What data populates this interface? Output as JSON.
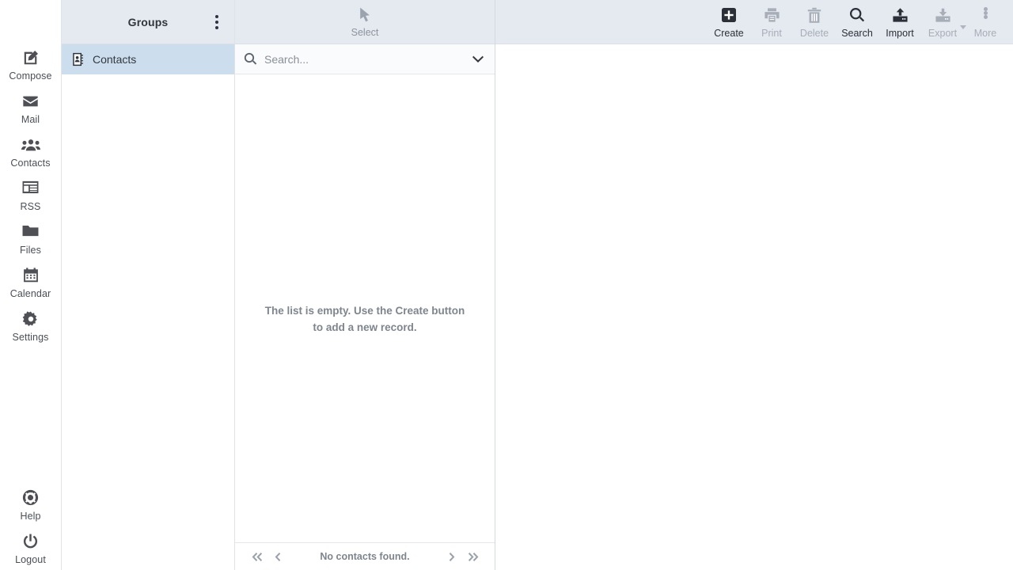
{
  "taskbar": {
    "items": [
      {
        "label": "Compose",
        "icon": "compose-icon"
      },
      {
        "label": "Mail",
        "icon": "envelope-icon"
      },
      {
        "label": "Contacts",
        "icon": "people-icon"
      },
      {
        "label": "RSS",
        "icon": "rss-list-icon"
      },
      {
        "label": "Files",
        "icon": "folder-icon"
      },
      {
        "label": "Calendar",
        "icon": "calendar-icon"
      },
      {
        "label": "Settings",
        "icon": "gear-icon"
      }
    ],
    "bottom_items": [
      {
        "label": "Help",
        "icon": "lifebuoy-icon"
      },
      {
        "label": "Logout",
        "icon": "power-icon"
      }
    ]
  },
  "groups": {
    "title": "Groups",
    "options_icon": "kebab-menu-icon",
    "items": [
      {
        "label": "Contacts",
        "icon": "addressbook-icon",
        "selected": true
      }
    ]
  },
  "list": {
    "select_button": {
      "label": "Select",
      "icon": "cursor-arrow-icon"
    },
    "search": {
      "placeholder": "Search...",
      "value": "",
      "icon": "search-icon",
      "dropdown_icon": "chevron-down-icon"
    },
    "empty_message_line1": "The list is empty. Use the Create button",
    "empty_message_line2": "to add a new record.",
    "footer": {
      "first_label": "«",
      "prev_label": "‹",
      "status": "No contacts found.",
      "next_label": "›",
      "last_label": "»"
    }
  },
  "toolbar": {
    "buttons": [
      {
        "label": "Create",
        "icon": "plus-box-icon",
        "disabled": false
      },
      {
        "label": "Print",
        "icon": "printer-icon",
        "disabled": true
      },
      {
        "label": "Delete",
        "icon": "trash-icon",
        "disabled": true
      },
      {
        "label": "Search",
        "icon": "search-icon",
        "disabled": false
      },
      {
        "label": "Import",
        "icon": "upload-icon",
        "disabled": false
      },
      {
        "label": "Export",
        "icon": "download-icon",
        "disabled": true,
        "has_arrow": true
      },
      {
        "label": "More",
        "icon": "ellipsis-icon",
        "disabled": true
      }
    ]
  },
  "colors": {
    "header_bg": "#e5e9f0",
    "selected_row_bg": "#ccddee",
    "text": "#2a2f38",
    "muted_text": "#7f858e",
    "disabled_text": "#a7aeb8",
    "panel_border": "#dcdfe6"
  }
}
